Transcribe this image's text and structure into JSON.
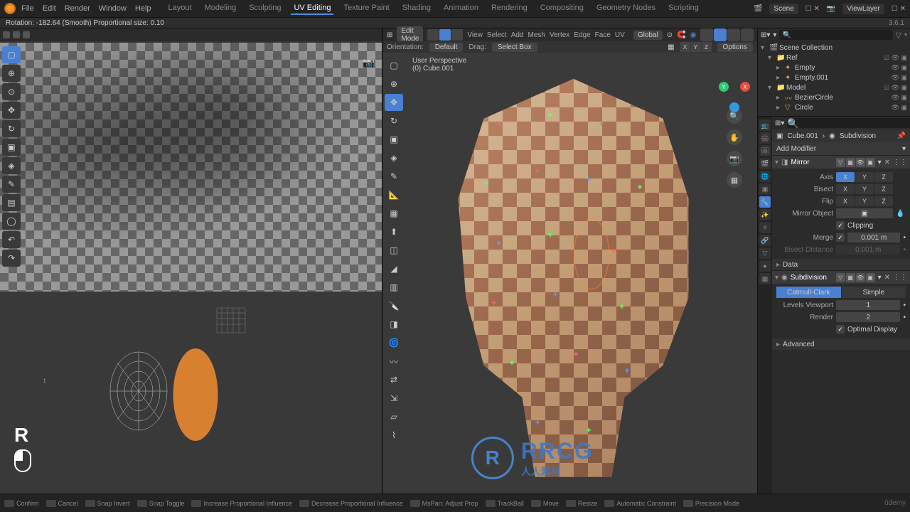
{
  "app": {
    "version": "3.6.1"
  },
  "topbar": {
    "menus": [
      "File",
      "Edit",
      "Render",
      "Window",
      "Help"
    ],
    "workspaces": [
      "Layout",
      "Modeling",
      "Sculpting",
      "UV Editing",
      "Texture Paint",
      "Shading",
      "Animation",
      "Rendering",
      "Compositing",
      "Geometry Nodes",
      "Scripting"
    ],
    "active_workspace": "UV Editing",
    "scene": "Scene",
    "view_layer": "ViewLayer"
  },
  "status_header": {
    "rotation_info": "Rotation: -182.64 (Smooth) Proportional size: 0.10"
  },
  "uv_editor": {
    "key_pressed": "R"
  },
  "viewport": {
    "mode": "Edit Mode",
    "menus": [
      "View",
      "Select",
      "Add",
      "Mesh",
      "Vertex",
      "Edge",
      "Face",
      "UV"
    ],
    "transform_orientation": "Global",
    "orientation_label": "Orientation:",
    "orientation_value": "Default",
    "drag_label": "Drag:",
    "drag_value": "Select Box",
    "options_label": "Options",
    "overlay": {
      "perspective": "User Perspective",
      "object": "(0) Cube.001"
    },
    "axes": [
      "X",
      "Y",
      "Z"
    ]
  },
  "outliner": {
    "root": "Scene Collection",
    "items": [
      {
        "name": "Ref",
        "indent": 10,
        "type": "collection"
      },
      {
        "name": "Empty",
        "indent": 22,
        "type": "empty"
      },
      {
        "name": "Empty.001",
        "indent": 22,
        "type": "empty"
      },
      {
        "name": "Model",
        "indent": 10,
        "type": "collection"
      },
      {
        "name": "BezierCircle",
        "indent": 22,
        "type": "curve"
      },
      {
        "name": "Circle",
        "indent": 22,
        "type": "mesh"
      }
    ]
  },
  "properties": {
    "breadcrumb_obj": "Cube.001",
    "breadcrumb_mod": "Subdivision",
    "add_modifier": "Add Modifier",
    "mirror": {
      "name": "Mirror",
      "axis_label": "Axis",
      "bisect_label": "Bisect",
      "flip_label": "Flip",
      "mirror_object_label": "Mirror Object",
      "clipping_label": "Clipping",
      "merge_label": "Merge",
      "merge_value": "0.001 m",
      "bisect_distance_label": "Bisect Distance",
      "bisect_distance_value": "0.001 m",
      "data_label": "Data"
    },
    "subdivision": {
      "name": "Subdivision",
      "type_catmull": "Catmull-Clark",
      "type_simple": "Simple",
      "levels_viewport_label": "Levels Viewport",
      "levels_viewport_value": "1",
      "levels_render_label": "Render",
      "levels_render_value": "2",
      "optimal_display_label": "Optimal Display",
      "advanced_label": "Advanced"
    }
  },
  "footer": {
    "items": [
      "Confirm",
      "Cancel",
      "Snap Invert",
      "Snap Toggle",
      "Increase Proportional Influence",
      "Decrease Proportional Influence",
      "MsPan: Adjust Prop",
      "TrackBall",
      "Move",
      "Resize",
      "Automatic Constraint",
      "Precision Mode"
    ],
    "brand": "ûdemy"
  },
  "watermark": {
    "big": "RRCG",
    "small": "人人素材"
  }
}
